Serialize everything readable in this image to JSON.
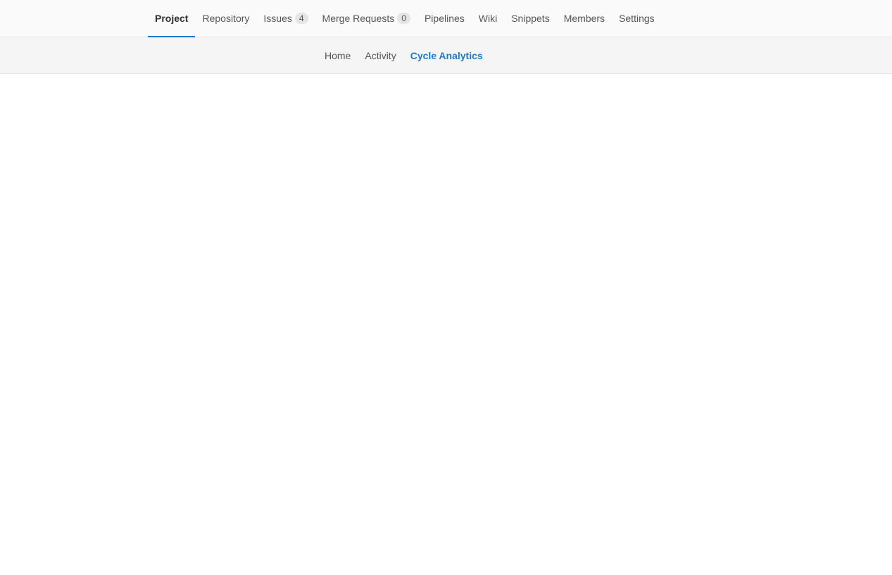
{
  "top_nav": {
    "tabs": [
      {
        "label": "Project",
        "active": true
      },
      {
        "label": "Repository"
      },
      {
        "label": "Issues",
        "badge": "4"
      },
      {
        "label": "Merge Requests",
        "badge": "0"
      },
      {
        "label": "Pipelines"
      },
      {
        "label": "Wiki"
      },
      {
        "label": "Snippets"
      },
      {
        "label": "Members"
      },
      {
        "label": "Settings"
      }
    ],
    "active_color": "#1f78d1"
  },
  "sub_nav": {
    "tabs": [
      {
        "label": "Home"
      },
      {
        "label": "Activity"
      },
      {
        "label": "Cycle Analytics",
        "active": true
      }
    ],
    "active_color": "#1f78d1"
  }
}
